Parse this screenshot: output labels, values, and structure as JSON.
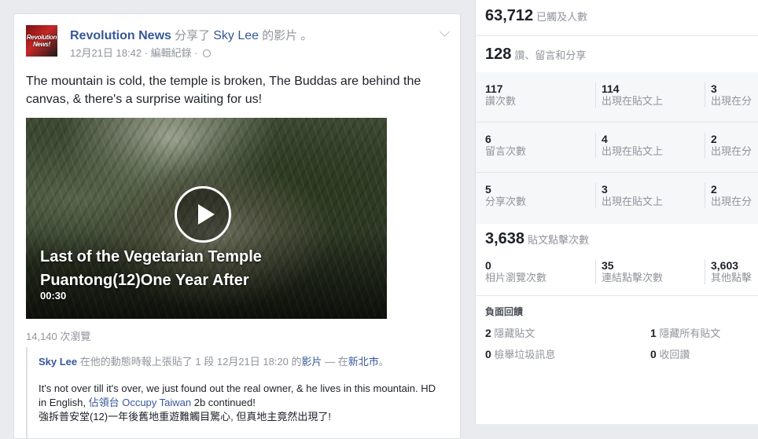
{
  "post": {
    "avatar_text": [
      "Revolution",
      "News!"
    ],
    "page_name": "Revolution News",
    "verb": " 分享了 ",
    "shared_person": "Sky Lee",
    "shared_object": " 的影片 。",
    "timestamp": "12月21日 18:42 · 編輯紀錄 · ",
    "message": "The mountain is cold, the temple is broken, The Buddas are behind the canvas, & there's a surprise waiting for us!",
    "video": {
      "title": "Last of the Vegetarian Temple Puantong(12)One Year After",
      "duration": "00:30"
    },
    "views": "14,140 次瀏覽",
    "shared_post": {
      "author": "Sky Lee",
      "line_a": " 在他的動態時報上張貼了 1 段 12月21日 18:20 的",
      "video_word": "影片",
      "line_b": " — 在",
      "location": "新北市",
      "line_end": "。",
      "text_1": "It's not over till it's over, we just found out the real owner, & he lives in this mountain. HD in English, ",
      "text_link": "佔領台 Occupy Taiwan",
      "text_2": " 2b continued!",
      "text_3": "強拆普安堂(12)一年後舊地重遊難觸目驚心, 但真地主竟然出現了!"
    }
  },
  "insights": {
    "reach": {
      "value": "63,712",
      "label": "已觸及人數"
    },
    "engagement": {
      "value": "128",
      "label": "讚、留言和分享"
    },
    "metric_rows": [
      {
        "cells": [
          {
            "n": "117",
            "l": "讚次數"
          },
          {
            "n": "114",
            "l": "出現在貼文上"
          },
          {
            "n": "3",
            "l": "出現在分"
          }
        ]
      },
      {
        "cells": [
          {
            "n": "6",
            "l": "留言次數"
          },
          {
            "n": "4",
            "l": "出現在貼文上"
          },
          {
            "n": "2",
            "l": "出現在分"
          }
        ]
      },
      {
        "cells": [
          {
            "n": "5",
            "l": "分享次數"
          },
          {
            "n": "3",
            "l": "出現在貼文上"
          },
          {
            "n": "2",
            "l": "出現在分"
          }
        ]
      }
    ],
    "clicks": {
      "value": "3,638",
      "label": "貼文點擊次數"
    },
    "click_cells": [
      {
        "n": "0",
        "l": "相片瀏覽次數"
      },
      {
        "n": "35",
        "l": "連結點擊次數"
      },
      {
        "n": "3,603",
        "l": "其他點擊"
      }
    ],
    "negative": {
      "title": "負面回饋",
      "items": [
        {
          "n": "2",
          "l": " 隱藏貼文"
        },
        {
          "n": "1",
          "l": " 隱藏所有貼文"
        },
        {
          "n": "0",
          "l": " 檢舉垃圾訊息"
        },
        {
          "n": "0",
          "l": " 收回讚"
        }
      ]
    }
  }
}
